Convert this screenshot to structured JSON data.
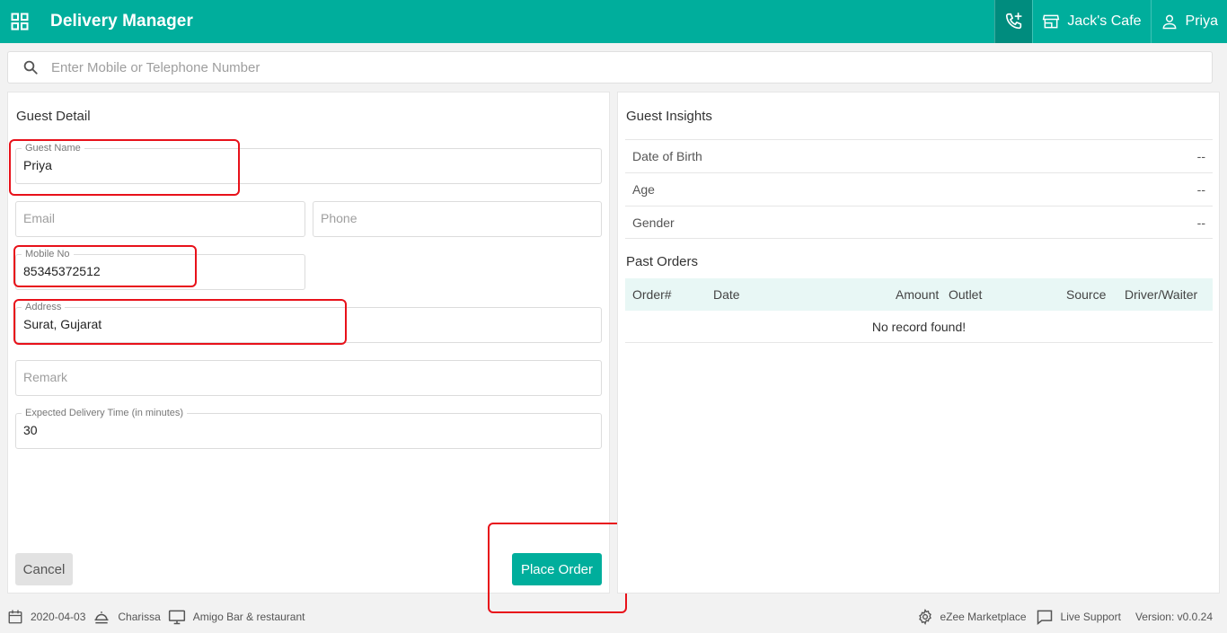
{
  "header": {
    "app_title": "Delivery Manager",
    "outlet": "Jack's Cafe",
    "user": "Priya"
  },
  "search": {
    "placeholder": "Enter Mobile or Telephone Number"
  },
  "guest_detail": {
    "title": "Guest Detail",
    "guest_name_label": "Guest Name",
    "guest_name_value": "Priya",
    "email_placeholder": "Email",
    "phone_placeholder": "Phone",
    "mobile_label": "Mobile No",
    "mobile_value": "85345372512",
    "address_label": "Address",
    "address_value": "Surat, Gujarat",
    "remark_placeholder": "Remark",
    "delivery_time_label": "Expected Delivery Time (in minutes)",
    "delivery_time_value": "30",
    "cancel_label": "Cancel",
    "place_order_label": "Place Order"
  },
  "guest_insights": {
    "title": "Guest Insights",
    "rows": [
      {
        "label": "Date of Birth",
        "value": "--"
      },
      {
        "label": "Age",
        "value": "--"
      },
      {
        "label": "Gender",
        "value": "--"
      }
    ]
  },
  "past_orders": {
    "title": "Past Orders",
    "columns": [
      "Order#",
      "Date",
      "Amount",
      "Outlet",
      "Source",
      "Driver/Waiter"
    ],
    "empty_text": "No record found!"
  },
  "footer": {
    "date": "2020-04-03",
    "waiter": "Charissa",
    "outlet": "Amigo Bar & restaurant",
    "marketplace": "eZee Marketplace",
    "support": "Live Support",
    "version": "Version: v0.0.24"
  },
  "colors": {
    "brand": "#00ae9c",
    "highlight": "#e8111a"
  }
}
